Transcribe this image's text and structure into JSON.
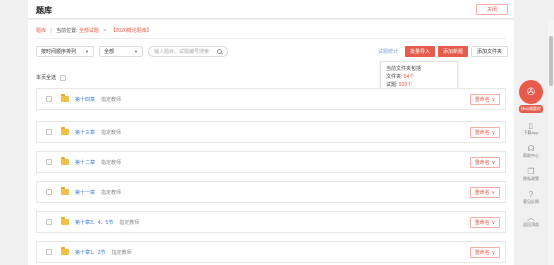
{
  "header": {
    "title": "题库",
    "close_label": "关闭"
  },
  "breadcrumb": {
    "home": "题库",
    "divider": "|",
    "current_label": "当前位置:",
    "all": "全部试题",
    "arrow": ">",
    "current": "【2020概论题库】"
  },
  "filters": {
    "sort": "按时间顺序排列",
    "type": "全部",
    "search_placeholder": "输入题目、试题编号搜索"
  },
  "actions": {
    "stats": "试题统计",
    "batch_import": "批量导入",
    "add_question": "添加新题",
    "add_folder": "添加文件夹"
  },
  "tooltip": {
    "title": "当前文件夹包括",
    "folders_label": "文件夹:",
    "folders_value": "64个",
    "questions_label": "试题:",
    "questions_value": "939个"
  },
  "select_all": "本页全选",
  "folders": [
    {
      "name": "第十四章",
      "note": "指定教师",
      "rename": "重命名"
    },
    {
      "name": "第十三章",
      "note": "指定教师",
      "rename": "重命名"
    },
    {
      "name": "第十二章",
      "note": "指定教师",
      "rename": "重命名"
    },
    {
      "name": "第十一章",
      "note": "指定教师",
      "rename": "重命名"
    },
    {
      "name": "第十章3、4、5节",
      "note": "指定教师",
      "rename": "重命名"
    },
    {
      "name": "第十章1、2节",
      "note": "指定教师",
      "rename": "重命名"
    }
  ],
  "sidebar": {
    "promo": "移动端题库",
    "download": "下载App",
    "help": "帮助中心",
    "privacy": "隐私政策",
    "feedback": "意见反馈",
    "top": "返回顶部"
  },
  "colors": {
    "accent": "#e65b4b",
    "link": "#3d7bd8",
    "folder": "#f0c04a"
  }
}
